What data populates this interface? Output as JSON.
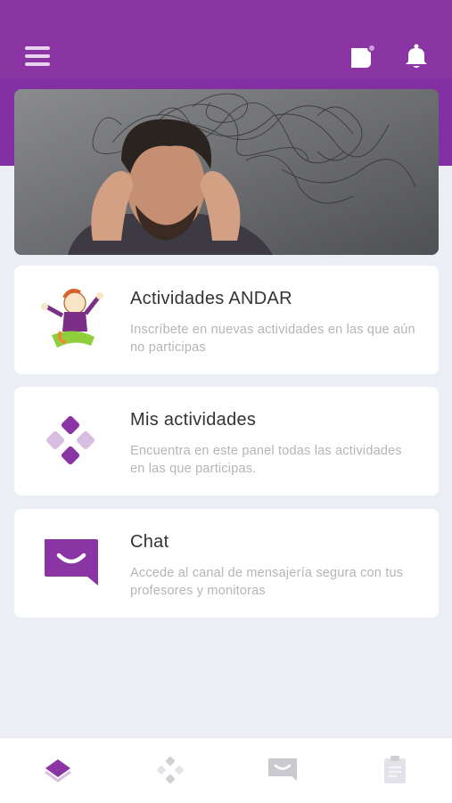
{
  "header": {
    "menu_icon": "hamburger-menu-icon",
    "calendar_icon": "calendar-icon",
    "bell_icon": "bell-icon"
  },
  "banner": {
    "image": "stressed-man-photo"
  },
  "cards": [
    {
      "title": "Actividades ANDAR",
      "description": "Inscríbete en nuevas actividades en las que aún no participas",
      "icon": "jumping-kid-illustration"
    },
    {
      "title": "Mis actividades",
      "description": "Encuentra en este panel todas las actividades en las que participas.",
      "icon": "diamond-cluster-icon"
    },
    {
      "title": "Chat",
      "description": "Accede al canal de mensajería segura con tus profesores y monitoras",
      "icon": "chat-bubble-icon"
    }
  ],
  "tabbar": {
    "items": [
      "layers-icon",
      "diamond-cluster-icon",
      "chat-bubble-icon",
      "clipboard-icon"
    ],
    "active": 0
  },
  "colors": {
    "brand": "#8a35a3",
    "background": "#eceef6",
    "card": "#ffffff"
  }
}
